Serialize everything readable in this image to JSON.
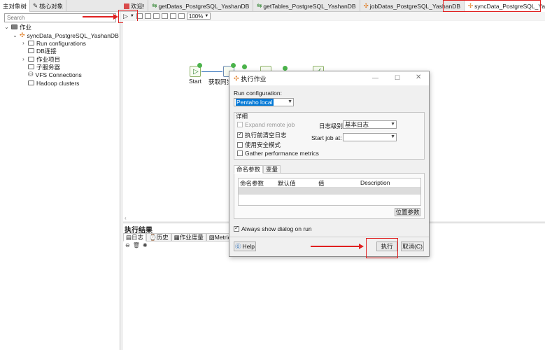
{
  "left_panel": {
    "tabs": [
      "主对象树",
      "核心对象"
    ],
    "search_placeholder": "Search",
    "tree": {
      "root": "作业",
      "job": "syncData_PostgreSQL_YashanDB",
      "items": [
        "Run configurations",
        "DB连接",
        "作业项目",
        "子服务器",
        "VFS Connections",
        "Hadoop clusters"
      ]
    }
  },
  "editor_tabs": [
    "欢迎!",
    "getDatas_PostgreSQL_YashanDB",
    "getTables_PostgreSQL_YashanDB",
    "jobDatas_PostgreSQL_YashanDB",
    "syncData_PostgreSQL_YashanDB"
  ],
  "toolbar": {
    "zoom": "100%"
  },
  "canvas": {
    "start_label": "Start",
    "step_label": "获取同步"
  },
  "results": {
    "title": "执行结果",
    "tabs": [
      "日志",
      "历史",
      "作业度量",
      "Metrics"
    ]
  },
  "dialog": {
    "title": "执行作业",
    "run_config_label": "Run configuration:",
    "run_config_value": "Pentaho local",
    "details_label": "详细",
    "expand_remote": "Expand remote job",
    "clear_log": "执行前清空日志",
    "safe_mode": "使用安全模式",
    "gather_metrics": "Gather performance metrics",
    "log_level_label": "日志级别",
    "log_level_value": "基本日志",
    "start_job_label": "Start job at:",
    "start_job_value": "",
    "tabs": [
      "命名参数",
      "变量"
    ],
    "table_headers": [
      "命名参数",
      "默认值",
      "值",
      "Description"
    ],
    "position_params": "位置参数",
    "always_show": "Always show dialog on run",
    "help": "Help",
    "execute": "执行",
    "cancel": "取消(C)"
  },
  "colors": {
    "highlight": "#e02020",
    "selection": "#0078d7"
  }
}
